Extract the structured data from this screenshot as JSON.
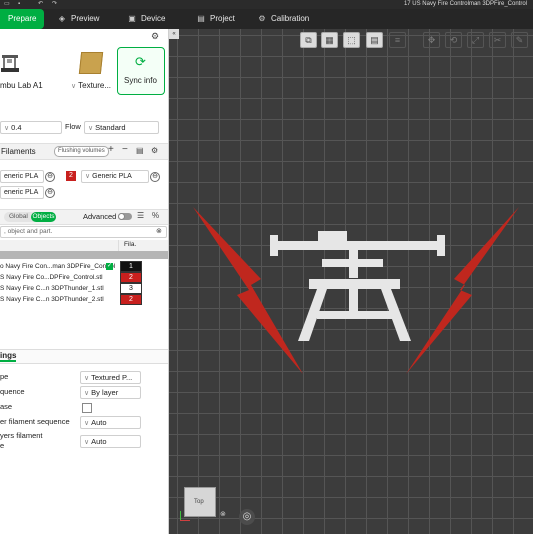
{
  "window": {
    "title": "17 US Navy Fire Controlman 3DPFire_Control"
  },
  "nav": {
    "tabs": [
      {
        "label": "Prepare",
        "icon": "home-icon"
      },
      {
        "label": "Preview",
        "icon": "eye-icon"
      },
      {
        "label": "Device",
        "icon": "device-icon"
      },
      {
        "label": "Project",
        "icon": "project-icon"
      },
      {
        "label": "Calibration",
        "icon": "gear-icon"
      }
    ]
  },
  "printer": {
    "name": "mbu Lab A1",
    "plate": "Texture...",
    "sync_label": "Sync info"
  },
  "nozzle": {
    "value": "0.4",
    "flow_label": "Flow",
    "flow_value": "Standard"
  },
  "filaments": {
    "header": "Filaments",
    "flushing_label": "Flushing volumes",
    "items": [
      {
        "label": "eneric PLA"
      },
      {
        "slot": "2",
        "label": "Generic PLA",
        "color": "#c8201e"
      },
      {
        "label": "eneric PLA"
      }
    ]
  },
  "objects": {
    "global_label": "Global",
    "objects_label": "Objects",
    "advanced_label": "Advanced",
    "search_placeholder": ", object and part.",
    "col_fila": "Fila.",
    "rows": [
      {
        "name": "o Navy Fire Con...man 3DPFire_Control",
        "fila": "1",
        "checked": true
      },
      {
        "name": "S Navy Fire Co...DPFire_Control.stl",
        "fila": "2"
      },
      {
        "name": "S Navy Fire C...n 3DPThunder_1.stl",
        "fila": "3"
      },
      {
        "name": "S Navy Fire C...n 3DPThunder_2.stl",
        "fila": "2"
      }
    ]
  },
  "settings": {
    "header": "ings",
    "rows": [
      {
        "label": "pe",
        "value": "Textured P..."
      },
      {
        "label": "quence",
        "value": "By layer"
      },
      {
        "label": "ase",
        "value": ""
      },
      {
        "label": "er filament sequence",
        "value": "Auto"
      },
      {
        "label": "yers filament",
        "value": "Auto"
      },
      {
        "label": "e",
        "value": ""
      }
    ]
  },
  "viewport": {
    "view_cube_label": "Top"
  },
  "colors": {
    "accent": "#00ae42",
    "bolt": "#c0271e",
    "model_white": "#e6e6e6",
    "fila_black": "#111111",
    "fila_red": "#c8201e"
  }
}
